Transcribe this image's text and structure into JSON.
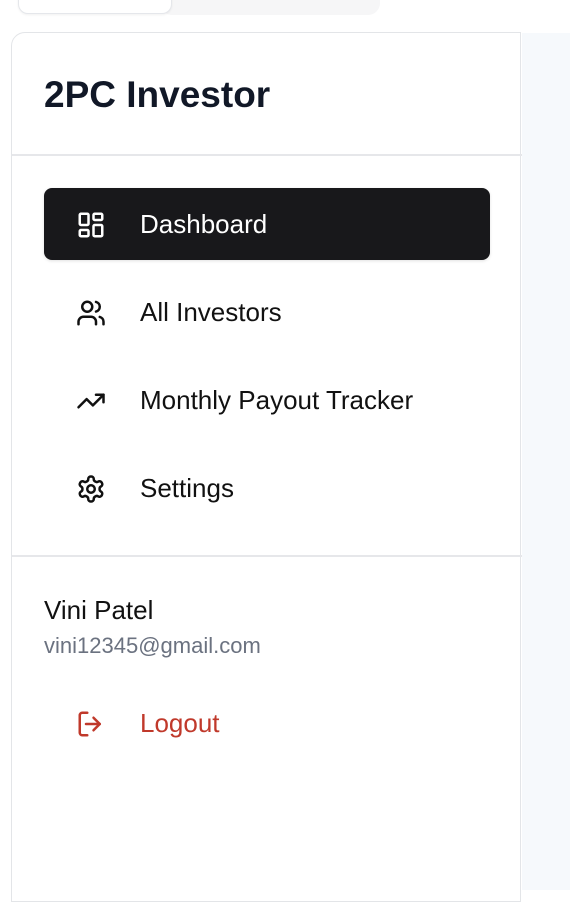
{
  "app": {
    "title": "2PC Investor"
  },
  "sidebar": {
    "items": [
      {
        "label": "Dashboard",
        "icon": "dashboard-icon",
        "active": true
      },
      {
        "label": "All Investors",
        "icon": "users-icon",
        "active": false
      },
      {
        "label": "Monthly Payout Tracker",
        "icon": "trending-up-icon",
        "active": false
      },
      {
        "label": "Settings",
        "icon": "gear-icon",
        "active": false
      }
    ]
  },
  "user": {
    "name": "Vini Patel",
    "email": "vini12345@gmail.com"
  },
  "logout": {
    "label": "Logout",
    "icon": "logout-icon"
  },
  "colors": {
    "active_bg": "#18181b",
    "logout": "#c0392b",
    "text": "#111111",
    "muted": "#6b7280"
  }
}
